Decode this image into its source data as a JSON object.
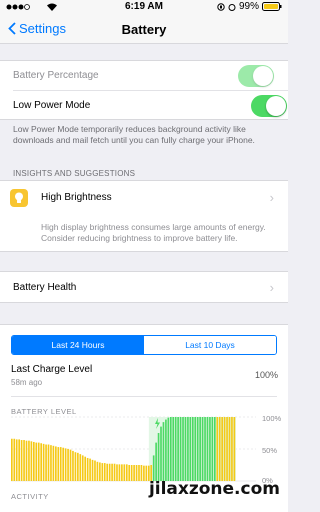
{
  "status_bar": {
    "time": "6:19 AM",
    "battery_percent": "99%"
  },
  "nav": {
    "back_label": "Settings",
    "title": "Battery"
  },
  "settings": [
    {
      "label": "Battery Percentage",
      "on": true,
      "disabled": true
    },
    {
      "label": "Low Power Mode",
      "on": true,
      "disabled": false
    }
  ],
  "low_power_note": "Low Power Mode temporarily reduces background activity like downloads and mail fetch until you can fully charge your iPhone.",
  "insights": {
    "header": "INSIGHTS AND SUGGESTIONS",
    "title": "High Brightness",
    "description": "High display brightness consumes large amounts of energy. Consider reducing brightness to improve battery life."
  },
  "battery_health": {
    "label": "Battery Health"
  },
  "usage": {
    "tabs": [
      "Last 24 Hours",
      "Last 10 Days"
    ],
    "active_tab": 0,
    "last_charge_title": "Last Charge Level",
    "last_charge_time": "58m ago",
    "last_charge_value": "100%"
  },
  "battery_level_chart": {
    "label": "BATTERY LEVEL",
    "y_ticks": [
      "100%",
      "50%",
      "0%"
    ],
    "colors": {
      "discharge": "#f5c916",
      "charging": "#4cd964",
      "low_power": "#f5c916"
    }
  },
  "activity_label": "ACTIVITY",
  "watermark": "jilaxzone.com",
  "chart_data": {
    "type": "bar",
    "ylim": [
      0,
      100
    ],
    "y_ticks": [
      "100%",
      "50%",
      "0%"
    ],
    "values": [
      66,
      66,
      65,
      65,
      64,
      64,
      63,
      63,
      62,
      61,
      60,
      60,
      59,
      58,
      57,
      57,
      56,
      55,
      54,
      53,
      53,
      52,
      51,
      50,
      49,
      47,
      45,
      44,
      42,
      40,
      38,
      36,
      35,
      33,
      32,
      30,
      29,
      28,
      28,
      27,
      27,
      27,
      27,
      26,
      26,
      26,
      26,
      26,
      25,
      25,
      25,
      25,
      25,
      25,
      24,
      24,
      24,
      25,
      40,
      60,
      75,
      85,
      92,
      96,
      99,
      100,
      100,
      100,
      100,
      100,
      100,
      100,
      100,
      100,
      100,
      100,
      100,
      100,
      100,
      100,
      100,
      100,
      100,
      100,
      100,
      100,
      100,
      100,
      100,
      100,
      100,
      100
    ],
    "charging_start_index": 58
  }
}
